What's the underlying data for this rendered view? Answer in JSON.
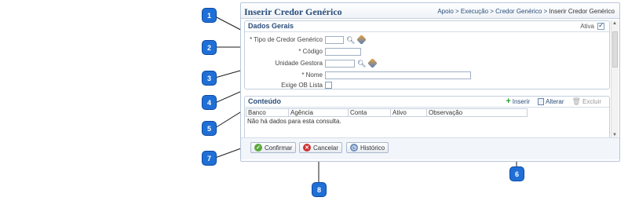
{
  "window": {
    "title": "Inserir Credor Genérico",
    "breadcrumb": {
      "trail": "Apoio > Execução > Credor Genérico > ",
      "current": "Inserir Credor Genérico"
    }
  },
  "dados_gerais": {
    "title": "Dados Gerais",
    "ativa_label": "Ativa",
    "ativa_checked": true,
    "fields": {
      "tipo_credor": {
        "label": "* Tipo de Credor Genérico",
        "value": ""
      },
      "codigo": {
        "label": "* Código",
        "value": ""
      },
      "unidade_gestora": {
        "label": "Unidade Gestora",
        "value": ""
      },
      "nome": {
        "label": "* Nome",
        "value": ""
      },
      "exige_ob_lista": {
        "label": "Exige OB Lista",
        "checked": false
      }
    }
  },
  "conteudo": {
    "title": "Conteúdo",
    "toolbar": {
      "inserir": "Inserir",
      "alterar": "Alterar",
      "excluir": "Excluir"
    },
    "columns": [
      "Banco",
      "Agência",
      "Conta",
      "Ativo",
      "Observação"
    ],
    "empty_message": "Não há dados para esta consulta."
  },
  "footer": {
    "confirmar": "Confirmar",
    "cancelar": "Cancelar",
    "historico": "Histórico"
  },
  "callouts": [
    "1",
    "2",
    "3",
    "4",
    "5",
    "6",
    "7",
    "8"
  ],
  "colors": {
    "accent": "#2a4d7a",
    "callout": "#1f6fd6"
  }
}
